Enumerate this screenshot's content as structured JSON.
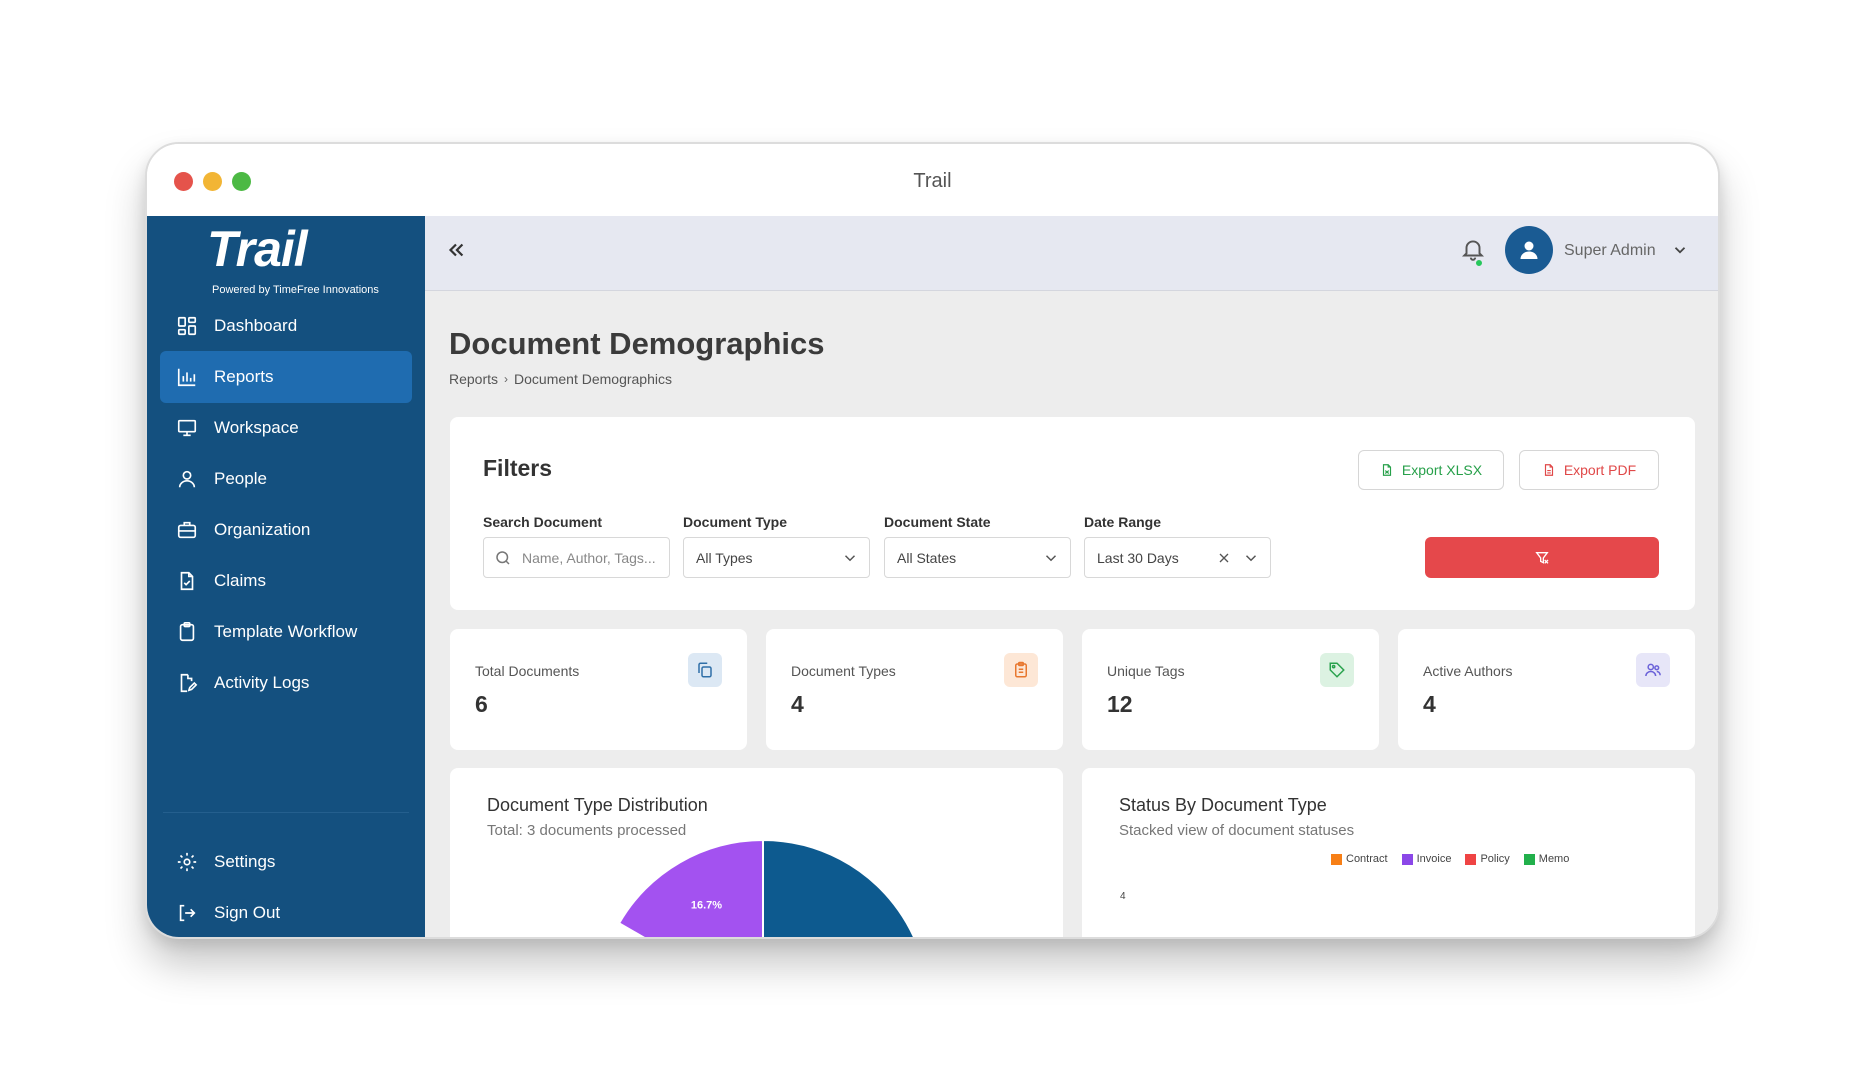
{
  "window": {
    "title": "Trail"
  },
  "sidebar": {
    "brand": "Trail",
    "brand_sub": "Powered by TimeFree Innovations",
    "items": [
      {
        "label": "Dashboard",
        "icon": "dashboard-icon"
      },
      {
        "label": "Reports",
        "icon": "bar-chart-icon",
        "active": true
      },
      {
        "label": "Workspace",
        "icon": "monitor-icon"
      },
      {
        "label": "People",
        "icon": "user-icon"
      },
      {
        "label": "Organization",
        "icon": "briefcase-icon"
      },
      {
        "label": "Claims",
        "icon": "file-check-icon"
      },
      {
        "label": "Template Workflow",
        "icon": "clipboard-icon"
      },
      {
        "label": "Activity Logs",
        "icon": "file-edit-icon"
      }
    ],
    "footer_items": [
      {
        "label": "Settings",
        "icon": "gear-icon"
      },
      {
        "label": "Sign Out",
        "icon": "sign-out-icon"
      }
    ]
  },
  "header": {
    "collapse_label": "«",
    "user_name": "Super Admin",
    "notification_status_color": "#26c75b"
  },
  "page": {
    "title": "Document Demographics",
    "breadcrumb": {
      "parent": "Reports",
      "separator": "›",
      "current": "Document Demographics"
    }
  },
  "filters": {
    "title": "Filters",
    "export_xlsx": "Export XLSX",
    "export_pdf": "Export PDF",
    "search": {
      "label": "Search Document",
      "placeholder": "Name, Author, Tags..."
    },
    "doc_type": {
      "label": "Document Type",
      "value": "All Types"
    },
    "doc_state": {
      "label": "Document State",
      "value": "All States"
    },
    "date_range": {
      "label": "Date Range",
      "value": "Last 30 Days"
    }
  },
  "stats": [
    {
      "label": "Total Documents",
      "value": "6",
      "icon": "copy-icon",
      "color": "#2f6fa8",
      "bg": "#dce8f4"
    },
    {
      "label": "Document Types",
      "value": "4",
      "icon": "clipboard-list-icon",
      "color": "#e8772e",
      "bg": "#fde7d6"
    },
    {
      "label": "Unique Tags",
      "value": "12",
      "icon": "tag-icon",
      "color": "#2aa24e",
      "bg": "#dcf2e2"
    },
    {
      "label": "Active Authors",
      "value": "4",
      "icon": "users-icon",
      "color": "#6b62d9",
      "bg": "#e7e6f8"
    }
  ],
  "charts": {
    "distribution": {
      "title": "Document Type Distribution",
      "subtitle": "Total: 3 documents processed",
      "visible_label": "16.7%"
    },
    "status": {
      "title": "Status By Document Type",
      "subtitle": "Stacked view of document statuses",
      "y_tick_visible": "4"
    }
  },
  "chart_data": [
    {
      "type": "pie",
      "title": "Document Type Distribution",
      "slices": [
        {
          "label": "",
          "value": 16.7,
          "color": "#a352f0",
          "display": "16.7%"
        },
        {
          "label": "",
          "value": 33.3,
          "color": "#0d5a8f"
        }
      ]
    },
    {
      "type": "bar",
      "stacked": true,
      "title": "Status By Document Type",
      "series": [
        {
          "name": "Contract",
          "color": "#f77f16"
        },
        {
          "name": "Invoice",
          "color": "#8b47e8"
        },
        {
          "name": "Policy",
          "color": "#ef4444"
        },
        {
          "name": "Memo",
          "color": "#22b04b"
        }
      ],
      "legend_position": "top-right",
      "y_ticks_visible": [
        4
      ]
    }
  ]
}
